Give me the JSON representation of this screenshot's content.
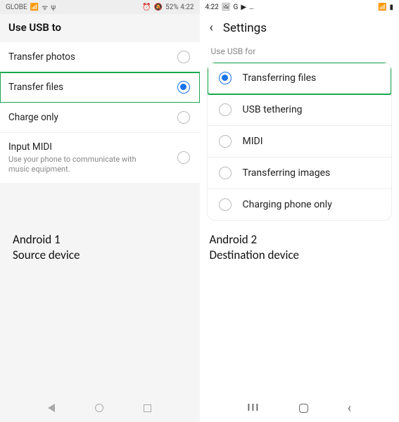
{
  "left": {
    "statusbar": {
      "carrier": "GLOBE",
      "right": "52%  4:22"
    },
    "title": "Use USB to",
    "options": [
      {
        "label": "Transfer photos",
        "selected": false,
        "highlight": false
      },
      {
        "label": "Transfer files",
        "selected": true,
        "highlight": true
      },
      {
        "label": "Charge only",
        "selected": false,
        "highlight": false
      },
      {
        "label": "Input MIDI",
        "sub": "Use your phone to communicate with music equipment.",
        "selected": false,
        "highlight": false
      }
    ],
    "caption_line1": "Android 1",
    "caption_line2": "Source device"
  },
  "right": {
    "statusbar": {
      "left": "4:22",
      "icons": "…"
    },
    "back": "‹",
    "title": "Settings",
    "section": "Use USB for",
    "options": [
      {
        "label": "Transferring files",
        "selected": true,
        "highlight": true
      },
      {
        "label": "USB tethering",
        "selected": false,
        "highlight": false
      },
      {
        "label": "MIDI",
        "selected": false,
        "highlight": false
      },
      {
        "label": "Transferring images",
        "selected": false,
        "highlight": false
      },
      {
        "label": "Charging phone only",
        "selected": false,
        "highlight": false
      }
    ],
    "caption_line1": "Android 2",
    "caption_line2": "Destination device",
    "nav": {
      "recents": "III",
      "back": "‹"
    }
  }
}
